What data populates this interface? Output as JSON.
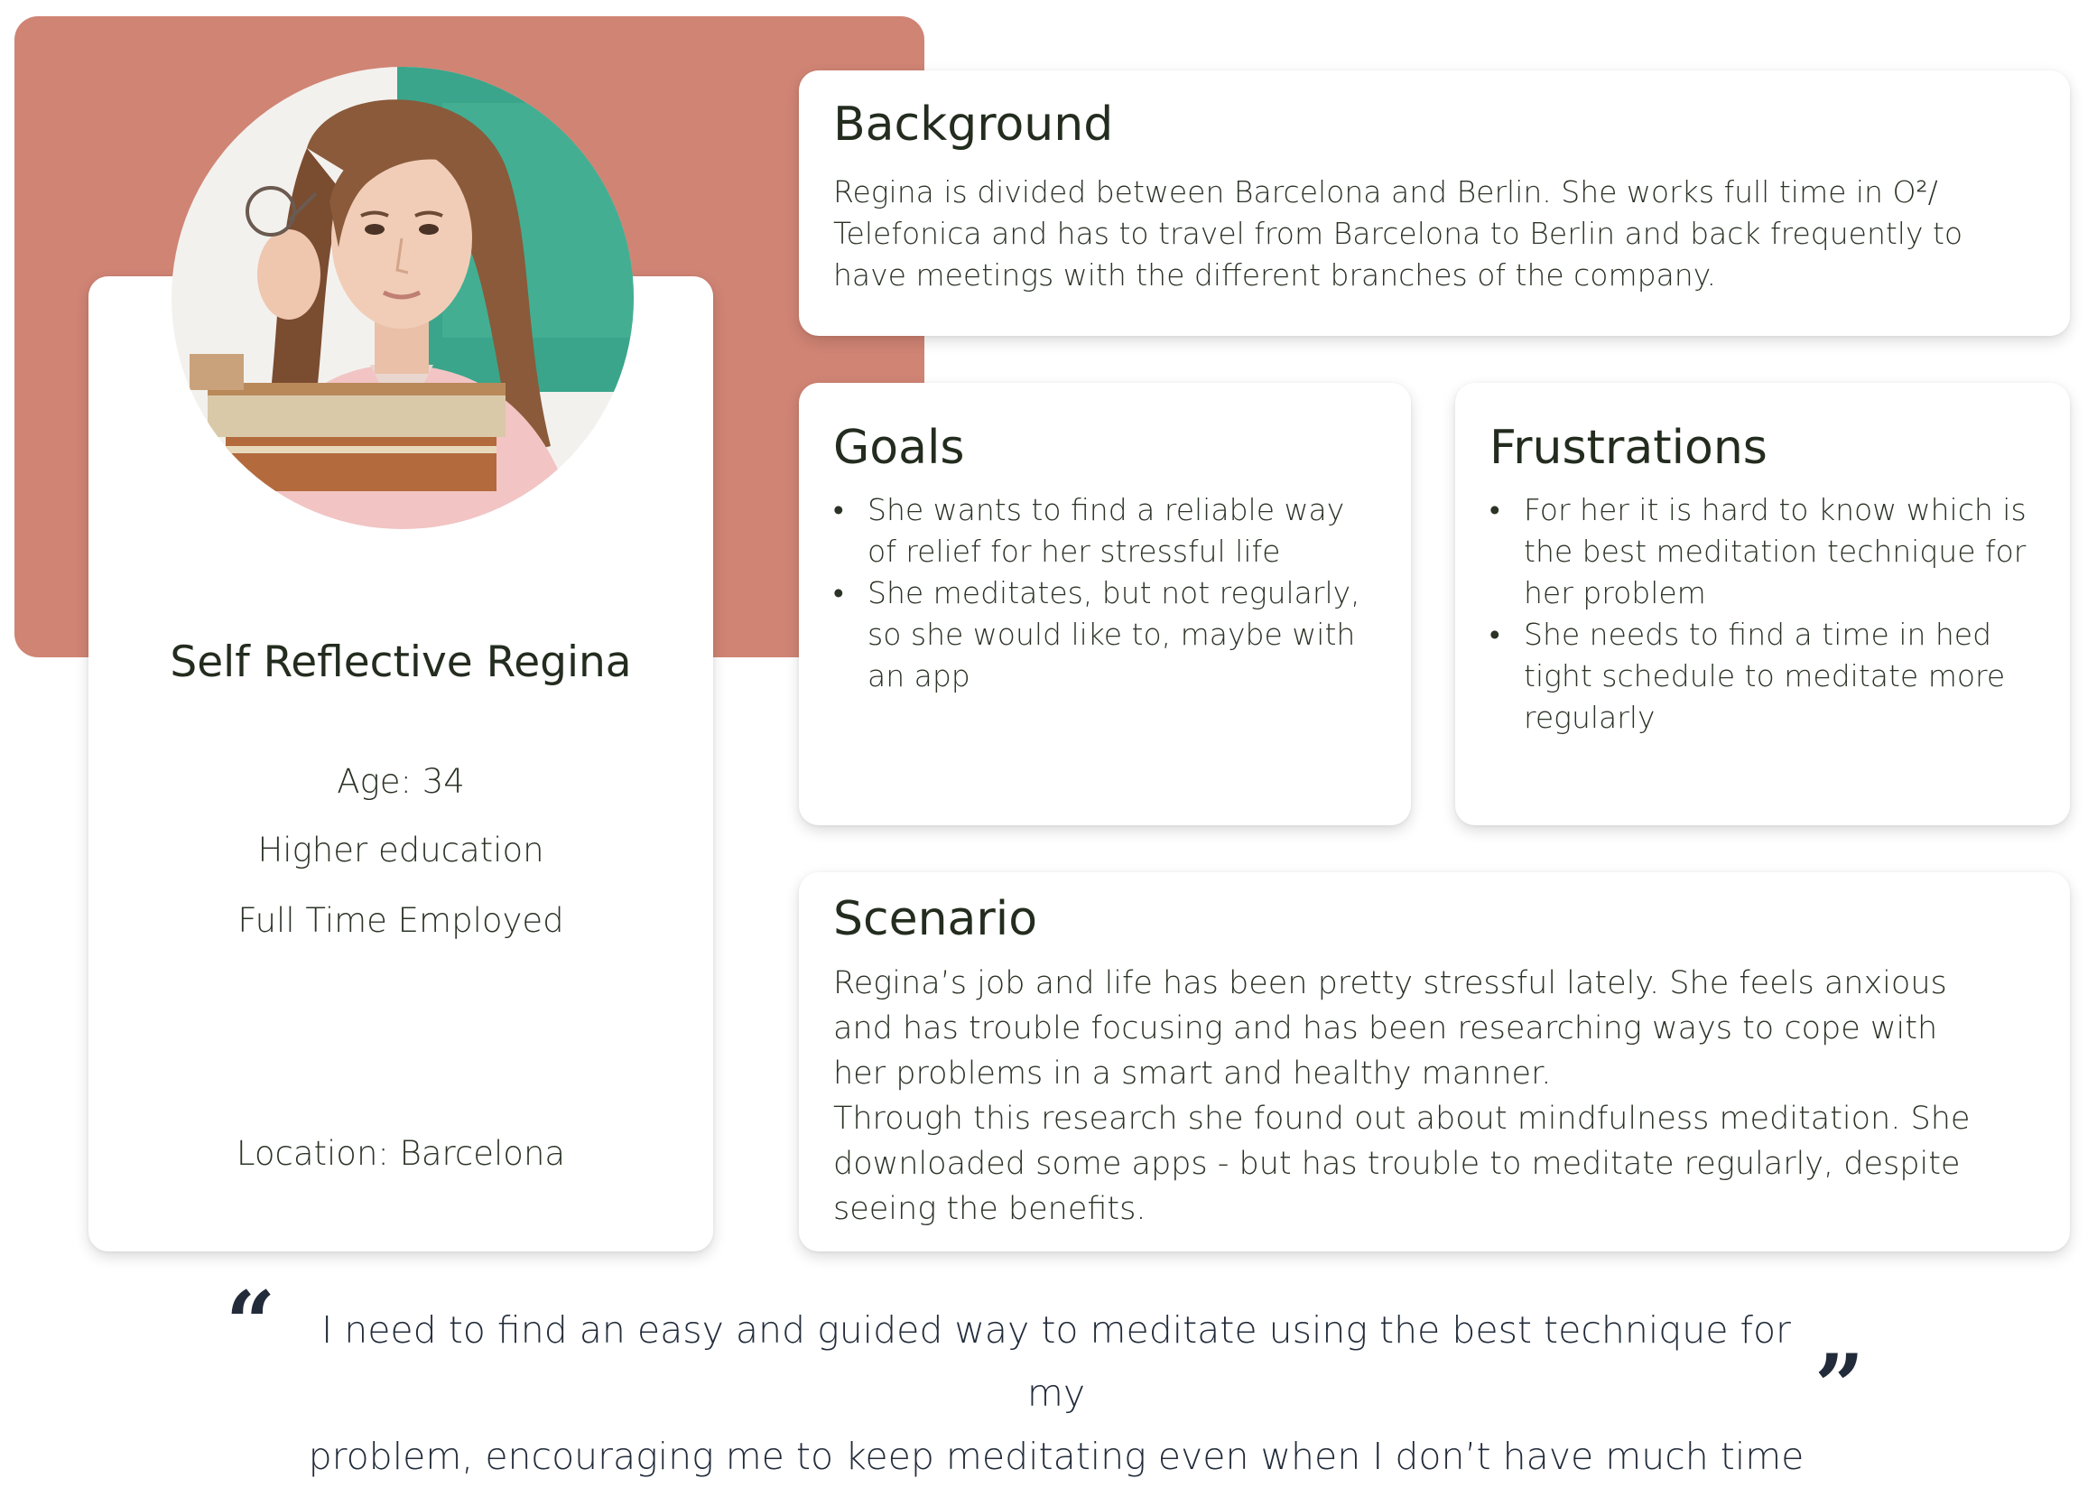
{
  "persona": {
    "name": "Self Reflective Regina",
    "age": "Age: 34",
    "education": "Higher education",
    "employment": "Full Time Employed",
    "location": "Location: Barcelona",
    "photo_icon": "woman-portrait-photo"
  },
  "background": {
    "title": "Background",
    "lines": [
      "Regina is divided between Barcelona and Berlin. She works full time in O²/",
      "Telefonica and has to travel from Barcelona to Berlin and back frequently to",
      "have meetings with the different branches of the company."
    ]
  },
  "goals": {
    "title": "Goals",
    "items": [
      [
        "She wants to find a reliable way",
        "of relief for her stressful life"
      ],
      [
        "She meditates, but not regularly,",
        "so she would like to, maybe with",
        "an app"
      ]
    ]
  },
  "frustrations": {
    "title": "Frustrations",
    "items": [
      [
        "For her it is hard to know which is",
        "the best meditation technique for",
        "her problem"
      ],
      [
        "She needs to find a time in hed",
        "tight schedule to meditate more",
        "regularly"
      ]
    ]
  },
  "scenario": {
    "title": "Scenario",
    "lines": [
      "Regina’s job and life has been pretty stressful lately. She feels anxious",
      "and has trouble focusing and has been researching ways to cope with",
      "her problems in a smart and healthy manner.",
      "Through this research she found out about mindfulness meditation. She",
      "downloaded some apps - but has trouble to meditate regularly, despite",
      "seeing the benefits."
    ]
  },
  "quote": {
    "open_mark": "“",
    "close_mark": "”",
    "lines": [
      "I need to find an easy and guided way to meditate using the best technique for my",
      "problem, encouraging me to keep meditating even when I don’t have much time"
    ]
  },
  "colors": {
    "accent": "#d08474",
    "heading": "#232c1e",
    "body_text": "#2b3326",
    "quote_text": "#222b3a",
    "card": "#ffffff"
  }
}
